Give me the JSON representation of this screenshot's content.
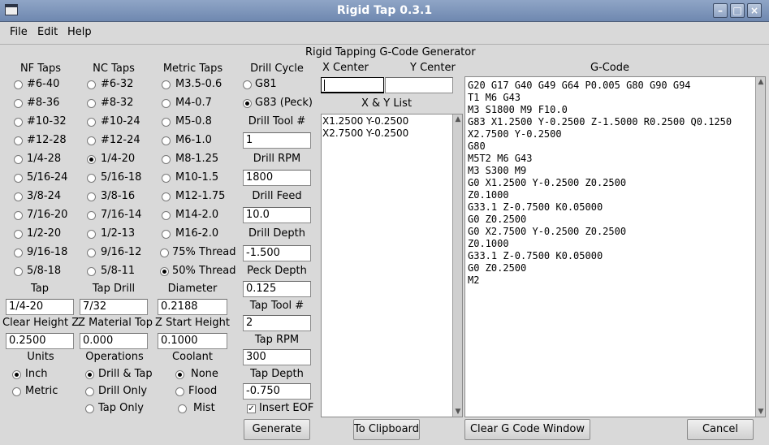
{
  "window": {
    "title": "Rigid Tap 0.3.1"
  },
  "menu": {
    "file": "File",
    "edit": "Edit",
    "help": "Help"
  },
  "heading": "Rigid Tapping G-Code Generator",
  "nf": {
    "header": "NF Taps",
    "items": [
      "#6-40",
      "#8-36",
      "#10-32",
      "#12-28",
      "1/4-28",
      "5/16-24",
      "3/8-24",
      "7/16-20",
      "1/2-20",
      "9/16-18",
      "5/8-18"
    ]
  },
  "nc": {
    "header": "NC Taps",
    "items": [
      "#6-32",
      "#8-32",
      "#10-24",
      "#12-24",
      "1/4-20",
      "5/16-18",
      "3/8-16",
      "7/16-14",
      "1/2-13",
      "9/16-12",
      "5/8-11"
    ],
    "selected": "1/4-20"
  },
  "metric": {
    "header": "Metric Taps",
    "items": [
      "M3.5-0.6",
      "M4-0.7",
      "M5-0.8",
      "M6-1.0",
      "M8-1.25",
      "M10-1.5",
      "M12-1.75",
      "M14-2.0",
      "M16-2.0"
    ],
    "thread75": "75% Thread",
    "thread50": "50% Thread"
  },
  "drill": {
    "cycle_header": "Drill Cycle",
    "g81": "G81",
    "g83": "G83 (Peck)",
    "tool_label": "Drill Tool #",
    "tool_value": "1",
    "rpm_label": "Drill RPM",
    "rpm_value": "1800",
    "feed_label": "Drill Feed",
    "feed_value": "10.0",
    "depth_label": "Drill Depth",
    "depth_value": "-1.500",
    "peck_label": "Peck Depth",
    "peck_value": "0.125",
    "tap_tool_label": "Tap Tool #",
    "tap_tool_value": "2",
    "tap_rpm_label": "Tap RPM",
    "tap_rpm_value": "300",
    "tap_depth_label": "Tap Depth",
    "tap_depth_value": "-0.750",
    "insert_eof": "Insert EOF"
  },
  "params": {
    "tap_label": "Tap",
    "tap_value": "1/4-20",
    "tap_drill_label": "Tap Drill",
    "tap_drill_value": "7/32",
    "diameter_label": "Diameter",
    "diameter_value": "0.2188",
    "clear_label": "Clear Height Z",
    "clear_value": "0.2500",
    "material_label": "Z Material Top",
    "material_value": "0.000",
    "start_label": "Z Start Height",
    "start_value": "0.1000"
  },
  "units": {
    "header": "Units",
    "inch": "Inch",
    "metric": "Metric"
  },
  "operations": {
    "header": "Operations",
    "drill_tap": "Drill & Tap",
    "drill_only": "Drill Only",
    "tap_only": "Tap Only"
  },
  "coolant": {
    "header": "Coolant",
    "none": "None",
    "flood": "Flood",
    "mist": "Mist"
  },
  "xy": {
    "x_label": "X Center",
    "y_label": "Y Center",
    "x_value": "",
    "y_value": "",
    "list_header": "X & Y List",
    "list_text": "X1.2500 Y-0.2500\nX2.7500 Y-0.2500"
  },
  "gcode": {
    "header": "G-Code",
    "text": "G20 G17 G40 G49 G64 P0.005 G80 G90 G94\nT1 M6 G43\nM3 S1800 M9 F10.0\nG83 X1.2500 Y-0.2500 Z-1.5000 R0.2500 Q0.1250\nX2.7500 Y-0.2500\nG80\nM5T2 M6 G43\nM3 S300 M9\nG0 X1.2500 Y-0.2500 Z0.2500\nZ0.1000\nG33.1 Z-0.7500 K0.05000\nG0 Z0.2500\nG0 X2.7500 Y-0.2500 Z0.2500\nZ0.1000\nG33.1 Z-0.7500 K0.05000\nG0 Z0.2500\nM2"
  },
  "buttons": {
    "generate": "Generate",
    "clipboard": "To Clipboard",
    "clear": "Clear G Code Window",
    "cancel": "Cancel"
  },
  "colors": {
    "titlebar": "#7b92b8",
    "window_bg": "#d9d9d9"
  },
  "icons": {
    "app": "window-icon",
    "minimize": "minimize-icon",
    "maximize": "maximize-icon",
    "close": "close-icon"
  }
}
